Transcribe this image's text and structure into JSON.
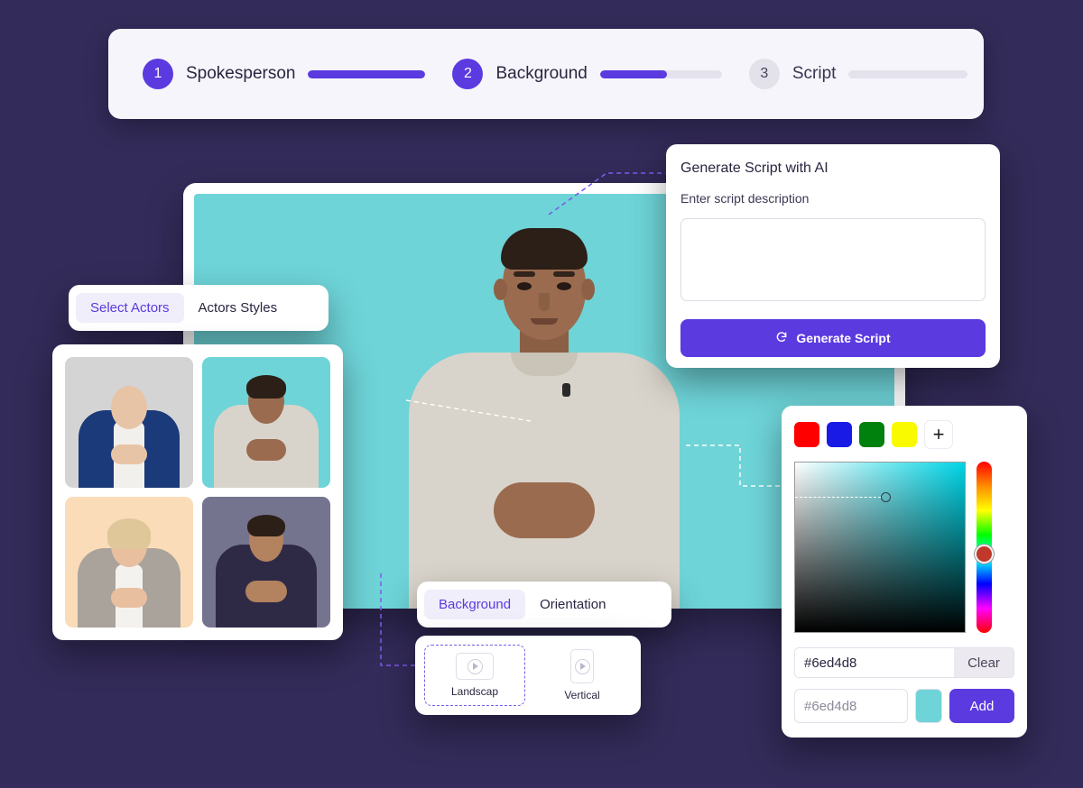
{
  "theme": {
    "background": "#332b59",
    "accent": "#5b3ae0",
    "stage_color": "#6ed4d8",
    "panel_bg": "#ffffff"
  },
  "stepper": {
    "steps": [
      {
        "number": "1",
        "label": "Spokesperson",
        "progress": 100,
        "state": "active"
      },
      {
        "number": "2",
        "label": "Background",
        "progress": 55,
        "state": "active"
      },
      {
        "number": "3",
        "label": "Script",
        "progress": 0,
        "state": "inactive"
      }
    ]
  },
  "script_panel": {
    "title": "Generate Script with AI",
    "subtitle": "Enter script description",
    "textarea_value": "",
    "textarea_placeholder": "",
    "button_label": "Generate Script",
    "button_icon": "refresh-icon"
  },
  "actors_panel": {
    "tabs": [
      {
        "label": "Select Actors",
        "active": true
      },
      {
        "label": "Actors Styles",
        "active": false
      }
    ],
    "thumbnails": [
      {
        "name": "actor-businesswoman",
        "bg": "#d4d4d4",
        "hair": "#b08c5f",
        "skin": "#e8c4a6",
        "outfit": "#1b3a7a"
      },
      {
        "name": "actor-man-teal",
        "bg": "#6ed4d8",
        "hair": "#2b1f18",
        "skin": "#9a6b4e",
        "outfit": "#d9d4cb"
      },
      {
        "name": "actor-senior-woman",
        "bg": "#fadcb8",
        "hair": "#e0c79a",
        "skin": "#e8bf9f",
        "outfit": "#a9a39c"
      },
      {
        "name": "actor-man-polo",
        "bg": "#74748f",
        "hair": "#2b1f18",
        "skin": "#b3825e",
        "outfit": "#2e2a46"
      }
    ]
  },
  "background_panel": {
    "tabs": [
      {
        "label": "Background",
        "active": true
      },
      {
        "label": "Orientation",
        "active": false
      }
    ],
    "orientations": [
      {
        "label": "Landscap",
        "icon": "play-landscape-icon",
        "selected": true
      },
      {
        "label": "Vertical",
        "icon": "play-vertical-icon",
        "selected": false
      }
    ]
  },
  "color_picker": {
    "swatches": [
      {
        "name": "swatch-red",
        "color": "#fe0000"
      },
      {
        "name": "swatch-blue",
        "color": "#1a1ae6"
      },
      {
        "name": "swatch-green",
        "color": "#00800c"
      },
      {
        "name": "swatch-yellow",
        "color": "#f9f900"
      }
    ],
    "add_swatch_icon": "plus-icon",
    "selected_color": "#6ed4d8",
    "hex_value": "#6ed4d8",
    "clear_label": "Clear",
    "add_input_placeholder": "#6ed4d8",
    "add_button_label": "Add",
    "saturation_handle": {
      "x_percent": 50,
      "y_percent": 18
    },
    "hue_handle": {
      "percent": 50
    }
  }
}
